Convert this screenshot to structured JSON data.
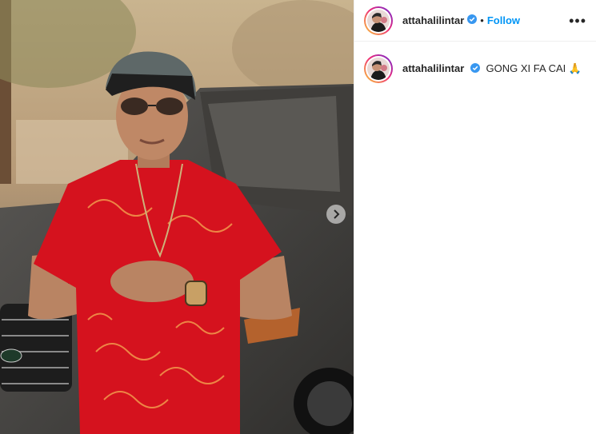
{
  "post": {
    "username": "attahalilintar",
    "verified": true,
    "separator": "•",
    "follow_label": "Follow",
    "more_label": "•••",
    "caption": "GONG XI FA CAI 🙏"
  },
  "icons": {
    "verified": "verified-badge-icon",
    "next": "chevron-right-icon",
    "more": "more-options-icon"
  },
  "colors": {
    "follow": "#0095f6",
    "verified": "#3897f0",
    "shirt": "#d5121e"
  }
}
